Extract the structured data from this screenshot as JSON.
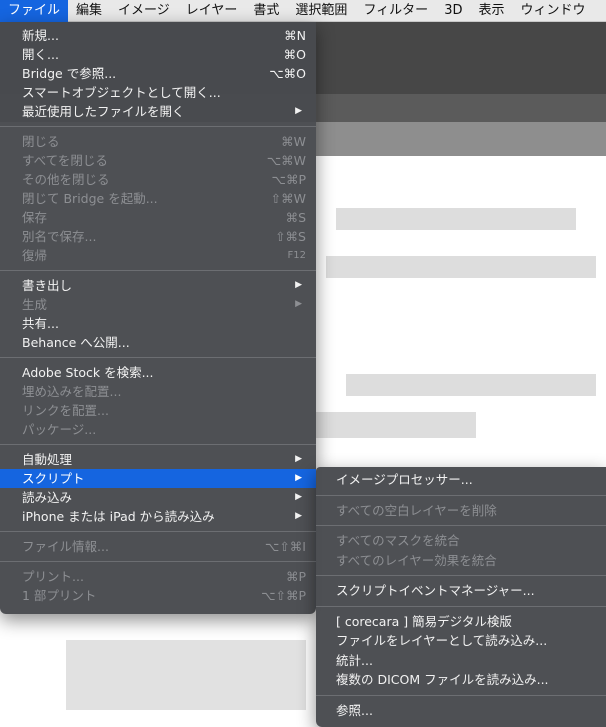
{
  "menubar": {
    "items": [
      "ファイル",
      "編集",
      "イメージ",
      "レイヤー",
      "書式",
      "選択範囲",
      "フィルター",
      "3D",
      "表示",
      "ウィンドウ"
    ]
  },
  "file_menu": {
    "items": [
      {
        "label": "新規...",
        "shortcut": "⌘N"
      },
      {
        "label": "開く...",
        "shortcut": "⌘O"
      },
      {
        "label": "Bridge で参照...",
        "shortcut": "⌥⌘O"
      },
      {
        "label": "スマートオブジェクトとして開く..."
      },
      {
        "label": "最近使用したファイルを開く",
        "submenu": true
      },
      {
        "separator": true
      },
      {
        "label": "閉じる",
        "shortcut": "⌘W",
        "disabled": true
      },
      {
        "label": "すべてを閉じる",
        "shortcut": "⌥⌘W",
        "disabled": true
      },
      {
        "label": "その他を閉じる",
        "shortcut": "⌥⌘P",
        "disabled": true
      },
      {
        "label": "閉じて Bridge を起動...",
        "shortcut": "⇧⌘W",
        "disabled": true
      },
      {
        "label": "保存",
        "shortcut": "⌘S",
        "disabled": true
      },
      {
        "label": "別名で保存...",
        "shortcut": "⇧⌘S",
        "disabled": true
      },
      {
        "label": "復帰",
        "shortcut": "F12",
        "disabled": true,
        "small_shortcut": true
      },
      {
        "separator": true
      },
      {
        "label": "書き出し",
        "submenu": true
      },
      {
        "label": "生成",
        "submenu": true,
        "disabled": true
      },
      {
        "label": "共有..."
      },
      {
        "label": "Behance へ公開..."
      },
      {
        "separator": true
      },
      {
        "label": "Adobe Stock を検索..."
      },
      {
        "label": "埋め込みを配置...",
        "disabled": true
      },
      {
        "label": "リンクを配置...",
        "disabled": true
      },
      {
        "label": "パッケージ...",
        "disabled": true
      },
      {
        "separator": true
      },
      {
        "label": "自動処理",
        "submenu": true
      },
      {
        "label": "スクリプト",
        "submenu": true,
        "highlighted": true
      },
      {
        "label": "読み込み",
        "submenu": true
      },
      {
        "label": "iPhone または iPad から読み込み",
        "submenu": true
      },
      {
        "separator": true
      },
      {
        "label": "ファイル情報...",
        "shortcut": "⌥⇧⌘I",
        "disabled": true
      },
      {
        "separator": true
      },
      {
        "label": "プリント...",
        "shortcut": "⌘P",
        "disabled": true
      },
      {
        "label": "1 部プリント",
        "shortcut": "⌥⇧⌘P",
        "disabled": true
      }
    ]
  },
  "script_menu": {
    "items": [
      {
        "label": "イメージプロセッサー..."
      },
      {
        "separator": true
      },
      {
        "label": "すべての空白レイヤーを削除",
        "disabled": true
      },
      {
        "separator": true
      },
      {
        "label": "すべてのマスクを統合",
        "disabled": true
      },
      {
        "label": "すべてのレイヤー効果を統合",
        "disabled": true
      },
      {
        "separator": true
      },
      {
        "label": "スクリプトイベントマネージャー..."
      },
      {
        "separator": true
      },
      {
        "label": "[ corecara ] 簡易デジタル検版"
      },
      {
        "label": "ファイルをレイヤーとして読み込み..."
      },
      {
        "label": "統計..."
      },
      {
        "label": "複数の DICOM ファイルを読み込み..."
      },
      {
        "separator": true
      },
      {
        "label": "参照..."
      }
    ]
  },
  "colors": {
    "accent": "#1565e0",
    "menu_bg": "#484a4e",
    "disabled_text": "#8d8f93"
  }
}
